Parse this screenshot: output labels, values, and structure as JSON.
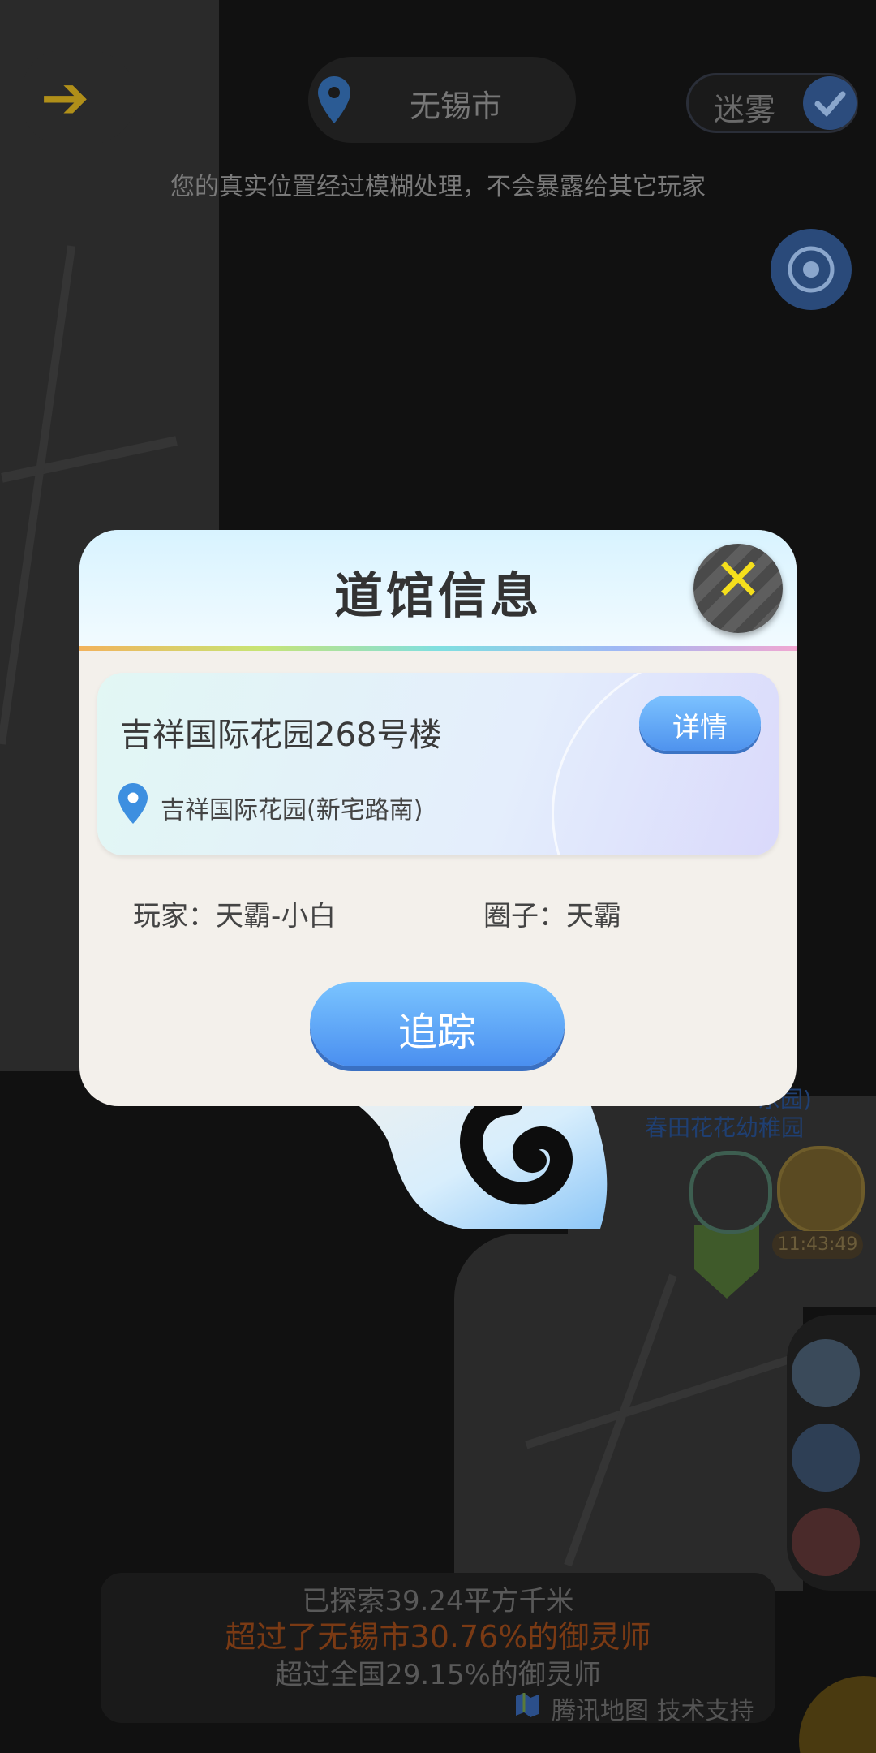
{
  "header": {
    "back_icon": "back-arrow-icon",
    "city": "无锡市",
    "fog_label": "迷雾",
    "privacy_note": "您的真实位置经过模糊处理，不会暴露给其它玩家"
  },
  "modal": {
    "title": "道馆信息",
    "close_icon": "close-icon",
    "gym_name": "吉祥国际花园268号楼",
    "detail_label": "详情",
    "address": "吉祥国际花园(新宅路南)",
    "player": "玩家：天霸-小白",
    "circle": "圈子：天霸",
    "track_label": "追踪"
  },
  "map": {
    "poi_partial": "东园)",
    "poi_name": "春田花花幼稚园",
    "timer": "11:43:49"
  },
  "stats": {
    "explored": "已探索39.24平方千米",
    "city_rank": "超过了无锡市30.76%的御灵师",
    "nation_rank": "超过全国29.15%的御灵师",
    "map_credit": "腾讯地图 技术支持"
  },
  "colors": {
    "accent_blue": "#4f93ee",
    "close_yellow": "#f5df1c",
    "highlight_orange": "#7a3a14"
  }
}
